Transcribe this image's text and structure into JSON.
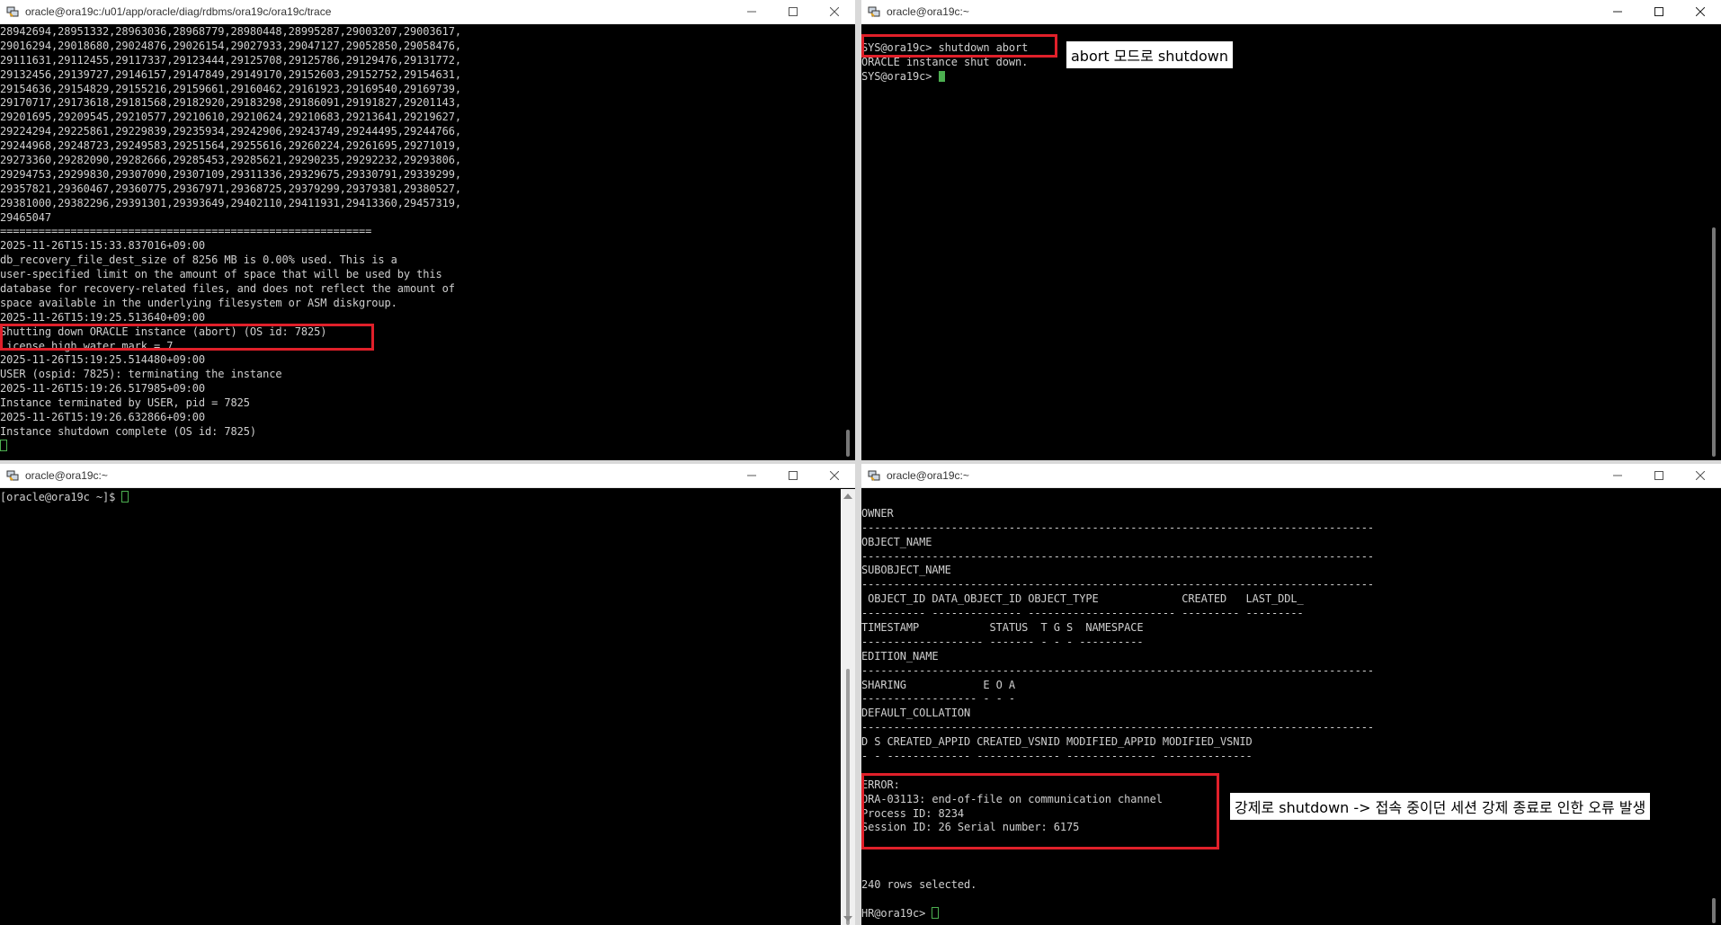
{
  "windows": {
    "top_left": {
      "title": "oracle@ora19c:/u01/app/oracle/diag/rdbms/ora19c/ora19c/trace",
      "lines": [
        "28942694,28951332,28963036,28968779,28980448,28995287,29003207,29003617,",
        "29016294,29018680,29024876,29026154,29027933,29047127,29052850,29058476,",
        "29111631,29112455,29117337,29123444,29125708,29125786,29129476,29131772,",
        "29132456,29139727,29146157,29147849,29149170,29152603,29152752,29154631,",
        "29154636,29154829,29155216,29159661,29160462,29161923,29169540,29169739,",
        "29170717,29173618,29181568,29182920,29183298,29186091,29191827,29201143,",
        "29201695,29209545,29210577,29210610,29210624,29210683,29213641,29219627,",
        "29224294,29225861,29229839,29235934,29242906,29243749,29244495,29244766,",
        "29244968,29248723,29249583,29251564,29255616,29260224,29261695,29271019,",
        "29273360,29282090,29282666,29285453,29285621,29290235,29292232,29293806,",
        "29294753,29299830,29307090,29307109,29311336,29329675,29330791,29339299,",
        "29357821,29360467,29360775,29367971,29368725,29379299,29379381,29380527,",
        "29381000,29382296,29391301,29393649,29402110,29411931,29413360,29457319,",
        "29465047",
        "==========================================================",
        "2025-11-26T15:15:33.837016+09:00",
        "db_recovery_file_dest_size of 8256 MB is 0.00% used. This is a",
        "user-specified limit on the amount of space that will be used by this",
        "database for recovery-related files, and does not reflect the amount of",
        "space available in the underlying filesystem or ASM diskgroup.",
        "2025-11-26T15:19:25.513640+09:00",
        "Shutting down ORACLE instance (abort) (OS id: 7825)",
        "License high water mark = 7",
        "2025-11-26T15:19:25.514480+09:00",
        "USER (ospid: 7825): terminating the instance",
        "2025-11-26T15:19:26.517985+09:00",
        "Instance terminated by USER, pid = 7825",
        "2025-11-26T15:19:26.632866+09:00",
        "Instance shutdown complete (OS id: 7825)"
      ]
    },
    "top_right": {
      "title": "oracle@ora19c:~",
      "lines": [
        "SYS@ora19c> shutdown abort",
        "ORACLE instance shut down.",
        "SYS@ora19c> "
      ],
      "annotation": "abort 모드로 shutdown"
    },
    "bottom_left": {
      "title": "oracle@ora19c:~",
      "lines": [
        "[oracle@ora19c ~]$ "
      ]
    },
    "bottom_right": {
      "title": "oracle@ora19c:~",
      "lines": [
        "",
        "OWNER",
        "--------------------------------------------------------------------------------",
        "OBJECT_NAME",
        "--------------------------------------------------------------------------------",
        "SUBOBJECT_NAME",
        "--------------------------------------------------------------------------------",
        " OBJECT_ID DATA_OBJECT_ID OBJECT_TYPE             CREATED   LAST_DDL_",
        "---------- -------------- ----------------------- --------- ---------",
        "TIMESTAMP           STATUS  T G S  NAMESPACE",
        "------------------- ------- - - - ----------",
        "EDITION_NAME",
        "--------------------------------------------------------------------------------",
        "SHARING            E O A",
        "------------------ - - -",
        "DEFAULT_COLLATION",
        "--------------------------------------------------------------------------------",
        "D S CREATED_APPID CREATED_VSNID MODIFIED_APPID MODIFIED_VSNID",
        "- - ------------- ------------- -------------- --------------",
        "",
        "ERROR:",
        "ORA-03113: end-of-file on communication channel",
        "Process ID: 8234",
        "Session ID: 26 Serial number: 6175",
        "",
        "",
        "",
        "240 rows selected.",
        "",
        "HR@ora19c> "
      ],
      "annotation": "강제로 shutdown -> 접속 중이던 세션 강제 종료로 인한 오류 발생"
    }
  },
  "colors": {
    "terminal_bg": "#000000",
    "terminal_fg": "#cfcfcf",
    "cursor": "#4caf50",
    "highlight_box": "#e0202a",
    "titlebar_bg": "#ffffff"
  },
  "icons": {
    "app": "putty-icon",
    "minimize": "minimize-icon",
    "maximize": "maximize-icon",
    "close": "close-icon"
  }
}
